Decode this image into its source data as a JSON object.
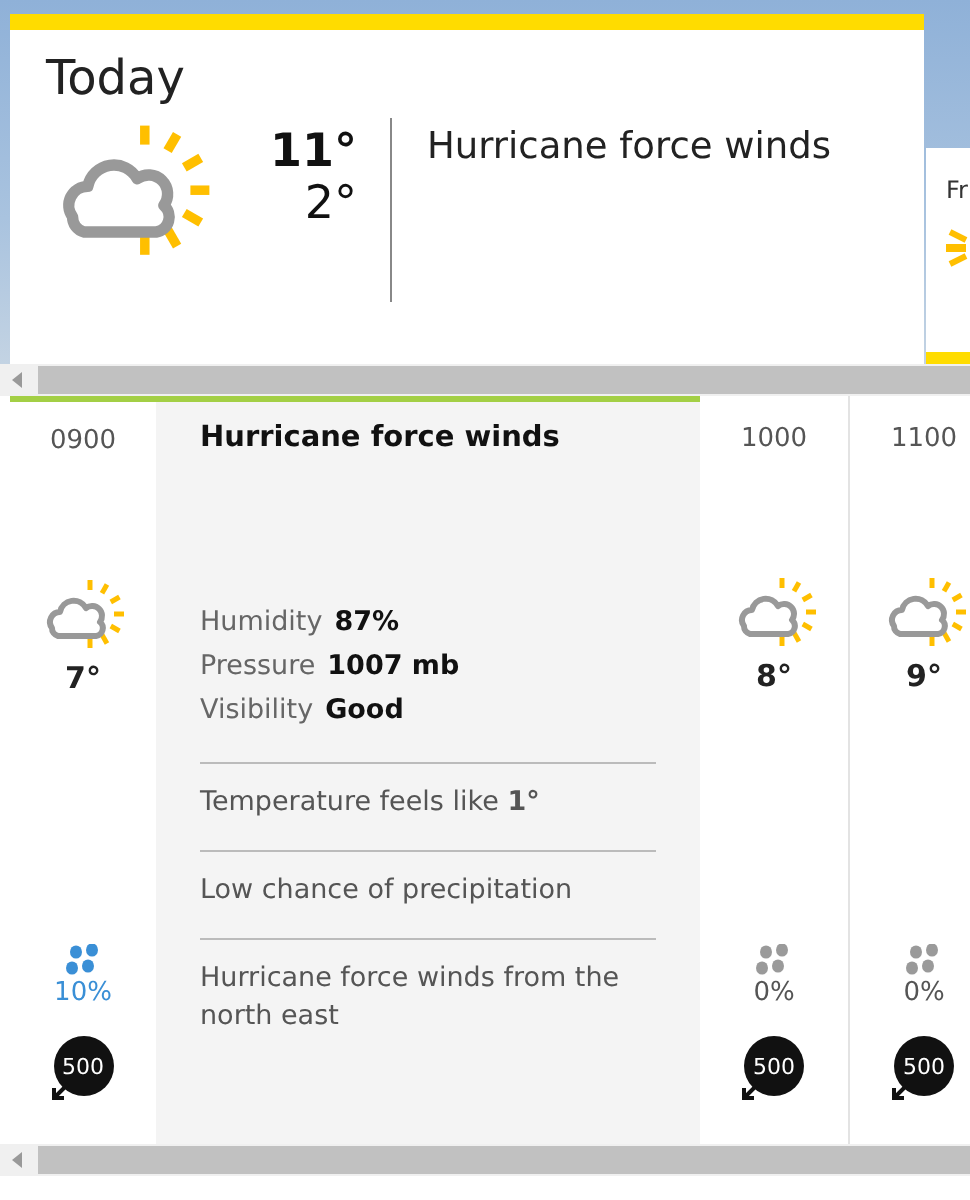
{
  "today": {
    "title": "Today",
    "high": "11°",
    "low": "2°",
    "summary": "Hurricane force winds"
  },
  "next_card": {
    "title": "Fr"
  },
  "hours": [
    {
      "time": "0900",
      "temp": "7°",
      "precipitation": "10%",
      "color": "#3a8fd6",
      "wind": "500",
      "selected": true
    },
    {
      "time": "1000",
      "temp": "8°",
      "precipitation": "0%",
      "color": "#9a9a9a",
      "wind": "500",
      "selected": false
    },
    {
      "time": "1100",
      "temp": "9°",
      "precipitation": "0%",
      "color": "#9a9a9a",
      "wind": "500",
      "selected": false
    }
  ],
  "details": {
    "title": "Hurricane force winds",
    "stats": [
      {
        "label": "Humidity",
        "value": "87%"
      },
      {
        "label": "Pressure",
        "value": "1007 mb"
      },
      {
        "label": "Visibility",
        "value": "Good"
      }
    ],
    "notes": [
      "Temperature feels like **1°**",
      "Low chance of precipitation",
      "Hurricane force winds from the north east"
    ]
  }
}
